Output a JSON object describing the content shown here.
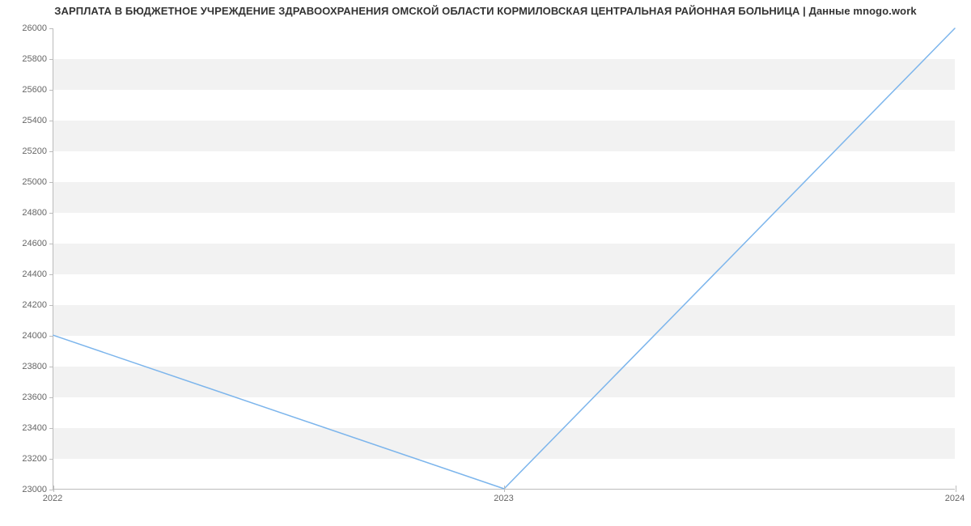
{
  "chart_data": {
    "type": "line",
    "title": "ЗАРПЛАТА В БЮДЖЕТНОЕ УЧРЕЖДЕНИЕ ЗДРАВООХРАНЕНИЯ ОМСКОЙ ОБЛАСТИ КОРМИЛОВСКАЯ ЦЕНТРАЛЬНАЯ РАЙОННАЯ БОЛЬНИЦА | Данные mnogo.work",
    "xlabel": "",
    "ylabel": "",
    "x": [
      "2022",
      "2023",
      "2024"
    ],
    "x_ticks": [
      "2022",
      "2023",
      "2024"
    ],
    "values": [
      24000,
      23000,
      26000
    ],
    "ylim": [
      23000,
      26000
    ],
    "y_ticks": [
      23000,
      23200,
      23400,
      23600,
      23800,
      24000,
      24200,
      24400,
      24600,
      24800,
      25000,
      25200,
      25400,
      25600,
      25800,
      26000
    ],
    "series_color": "#7cb5ec",
    "grid": "alternating_bands"
  }
}
